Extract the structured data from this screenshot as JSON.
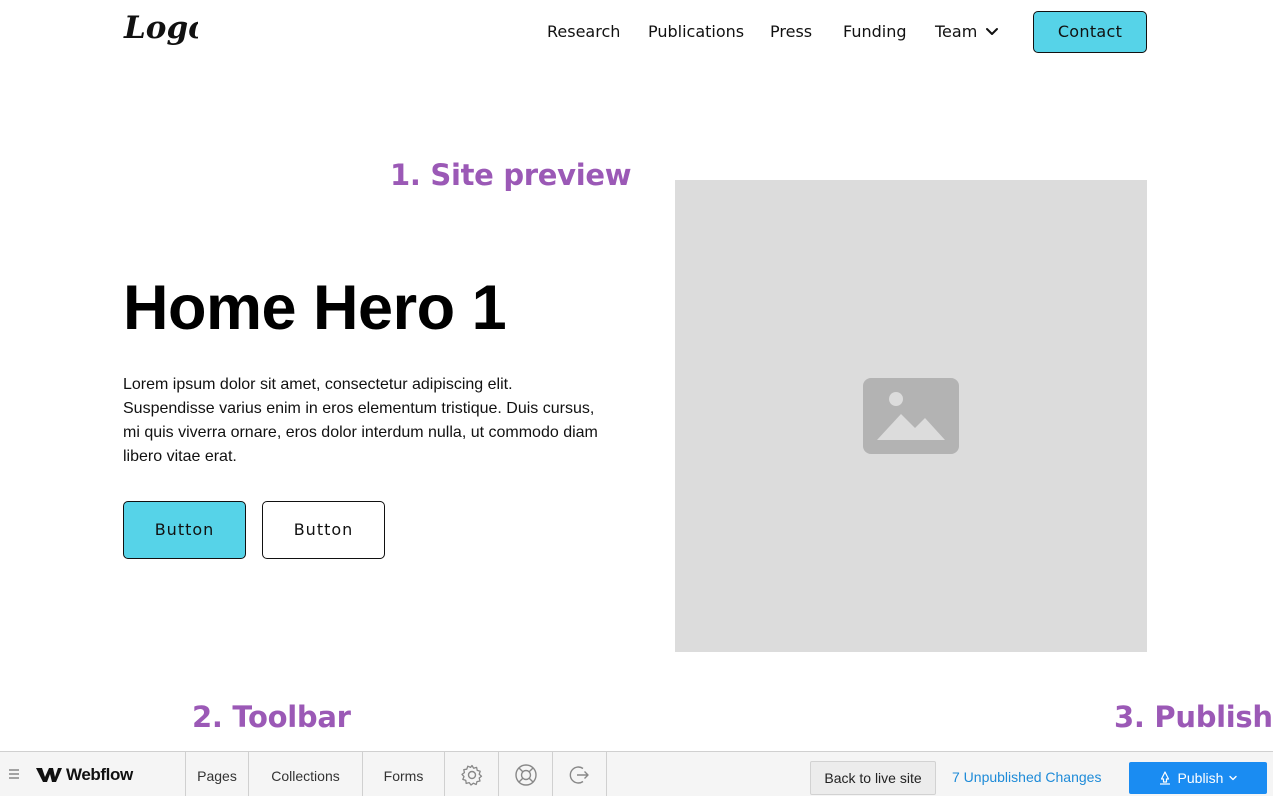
{
  "site": {
    "logo_text": "Logo",
    "nav": {
      "research": "Research",
      "publications": "Publications",
      "press": "Press",
      "funding": "Funding",
      "team": "Team",
      "contact": "Contact"
    },
    "hero": {
      "title": "Home Hero 1",
      "body": "Lorem ipsum dolor sit amet, consectetur adipiscing elit. Suspendisse varius enim in eros elementum tristique. Duis cursus, mi quis viverra ornare, eros dolor interdum nulla, ut commodo diam libero vitae erat.",
      "primary_button": "Button",
      "secondary_button": "Button",
      "image_icon": "image-placeholder-icon"
    }
  },
  "annotations": {
    "site_preview": "1. Site preview",
    "toolbar": "2. Toolbar",
    "publish": "3. Publish"
  },
  "toolbar": {
    "menu_icon": "menu-icon",
    "brand": "Webflow",
    "pages": "Pages",
    "collections": "Collections",
    "forms": "Forms",
    "settings_icon": "gear-icon",
    "help_icon": "help-icon",
    "exit_icon": "exit-icon",
    "back_to_live": "Back to live site",
    "unpublished_changes": "7 Unpublished Changes",
    "publish": "Publish"
  },
  "colors": {
    "accent_cyan": "#56d3e8",
    "annotation_purple": "#9b59b6",
    "publish_blue": "#1a8cf2",
    "link_blue": "#1e8bd8",
    "image_placeholder_bg": "#dcdcdc"
  }
}
